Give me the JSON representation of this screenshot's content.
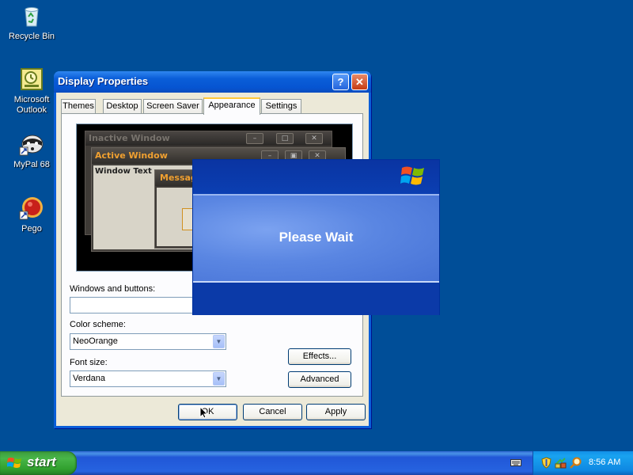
{
  "desktop": {
    "icons": [
      {
        "label": "Recycle Bin",
        "icon": "recycle-bin-icon"
      },
      {
        "label": "Microsoft Outlook",
        "icon": "outlook-icon"
      },
      {
        "label": "MyPal 68",
        "icon": "mypal-icon"
      },
      {
        "label": "Pego",
        "icon": "pego-icon"
      }
    ]
  },
  "window": {
    "title": "Display Properties",
    "help_glyph": "?",
    "close_glyph": "✕",
    "tabs": [
      {
        "label": "Themes"
      },
      {
        "label": "Desktop"
      },
      {
        "label": "Screen Saver"
      },
      {
        "label": "Appearance",
        "active": true
      },
      {
        "label": "Settings"
      }
    ],
    "preview": {
      "inactive_title": "Inactive Window",
      "active_title": "Active Window",
      "window_text": "Window Text",
      "message_title": "Message Box"
    },
    "windows_buttons_label": "Windows and buttons:",
    "windows_buttons_value": "",
    "color_scheme_label": "Color scheme:",
    "color_scheme_value": "NeoOrange",
    "font_size_label": "Font size:",
    "font_size_value": "Verdana",
    "effects_label": "Effects...",
    "advanced_label": "Advanced",
    "ok_label": "OK",
    "cancel_label": "Cancel",
    "apply_label": "Apply"
  },
  "splash": {
    "text": "Please Wait"
  },
  "taskbar": {
    "start_label": "start",
    "clock": "8:56 AM"
  },
  "colors": {
    "desktop": "#004e98",
    "title_bar": "#0a5ed8",
    "scheme_accent": "#f0a030",
    "start_green": "#3ba63b"
  }
}
